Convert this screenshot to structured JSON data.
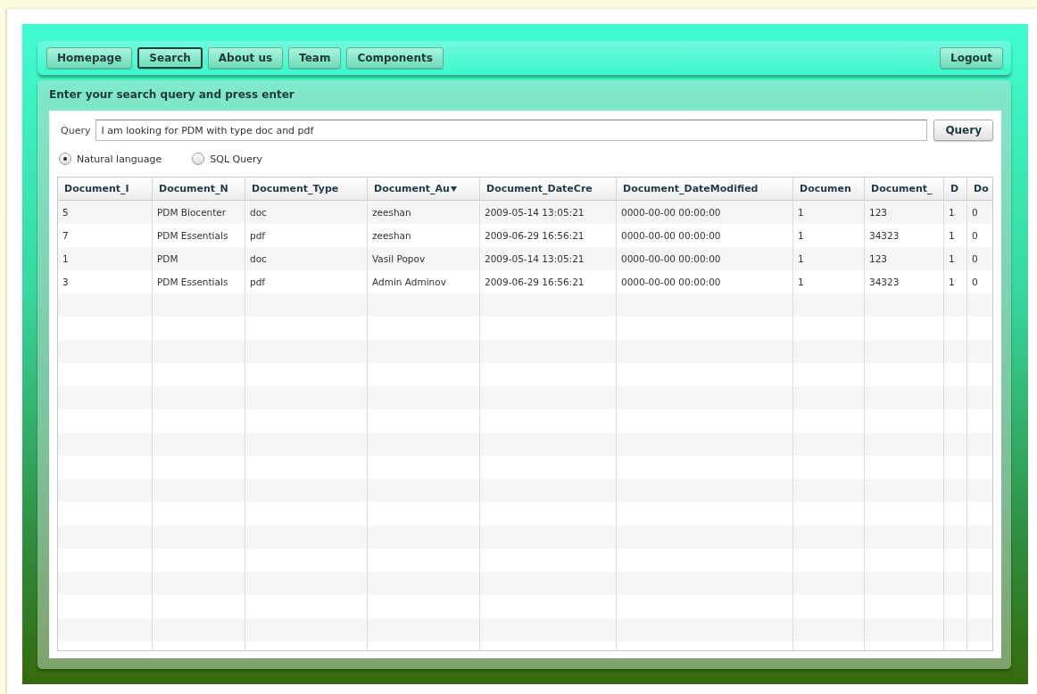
{
  "nav": {
    "tabs": [
      {
        "label": "Homepage",
        "selected": false
      },
      {
        "label": "Search",
        "selected": true
      },
      {
        "label": "About us",
        "selected": false
      },
      {
        "label": "Team",
        "selected": false
      },
      {
        "label": "Components",
        "selected": false
      }
    ],
    "logout": "Logout"
  },
  "panel": {
    "title": "Enter your search query and press enter",
    "query_label": "Query",
    "query_value": "I am looking for PDM with type doc and pdf",
    "query_button": "Query",
    "modes": [
      {
        "label": "Natural language",
        "selected": true
      },
      {
        "label": "SQL Query",
        "selected": false
      }
    ]
  },
  "table": {
    "columns": [
      {
        "label": "Document_I",
        "sorted": false
      },
      {
        "label": "Document_N",
        "sorted": false
      },
      {
        "label": "Document_Type",
        "sorted": false
      },
      {
        "label": "Document_Au",
        "sorted": true
      },
      {
        "label": "Document_DateCre",
        "sorted": false
      },
      {
        "label": "Document_DateModified",
        "sorted": false
      },
      {
        "label": "Documen",
        "sorted": false
      },
      {
        "label": "Document_",
        "sorted": false
      },
      {
        "label": "D",
        "sorted": false
      },
      {
        "label": "Do",
        "sorted": false
      }
    ],
    "rows": [
      [
        "5",
        "PDM Biocenter",
        "doc",
        "zeeshan",
        "2009-05-14 13:05:21",
        "0000-00-00 00:00:00",
        "1",
        "123",
        "1",
        "0"
      ],
      [
        "7",
        "PDM Essentials",
        "pdf",
        "zeeshan",
        "2009-06-29 16:56:21",
        "0000-00-00 00:00:00",
        "1",
        "34323",
        "1",
        "0"
      ],
      [
        "1",
        "PDM",
        "doc",
        "Vasil Popov",
        "2009-05-14 13:05:21",
        "0000-00-00 00:00:00",
        "1",
        "123",
        "1",
        "0"
      ],
      [
        "3",
        "PDM Essentials",
        "pdf",
        "Admin Adminov",
        "2009-06-29 16:56:21",
        "0000-00-00 00:00:00",
        "1",
        "34323",
        "1",
        "0"
      ]
    ]
  }
}
